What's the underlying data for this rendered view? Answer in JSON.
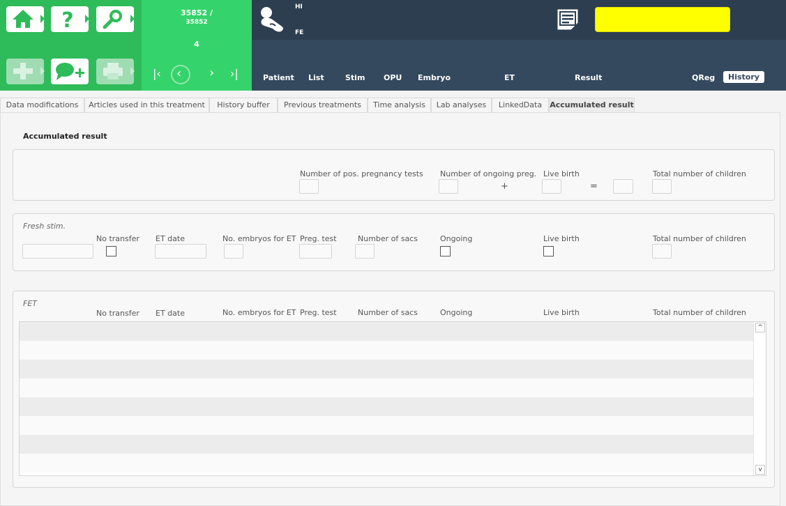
{
  "header": {
    "counter_top": "35852 /",
    "counter_sub": "35852",
    "counter_index": "4",
    "gender_top": "HI",
    "gender_bottom": "FE",
    "nav": {
      "first": "|‹",
      "prev": "‹",
      "next": "›",
      "last": "›|"
    },
    "nav_tabs": [
      "Patient",
      "List",
      "Stim",
      "OPU",
      "Embryo",
      "ET",
      "Result",
      "QReg",
      "History"
    ],
    "active_tab": "History",
    "colors": {
      "green": "#2ebb59",
      "green_light": "#35d36b",
      "dark": "#2c3e50",
      "dark2": "#34495e",
      "highlight": "#ffff00"
    }
  },
  "tabs": [
    "Data modifications",
    "Articles used in this treatment",
    "History buffer",
    "Previous treatments",
    "Time analysis",
    "Lab analyses",
    "LinkedData",
    "Accumulated result"
  ],
  "active_tab": "Accumulated result",
  "section_title": "Accumulated result",
  "summary": {
    "pos_preg_tests": "Number of pos. pregnancy tests",
    "ongoing_preg": "Number of ongoing preg.",
    "plus": "+",
    "live_birth": "Live birth",
    "equals": "=",
    "total_children": "Total number of children"
  },
  "fresh": {
    "title": "Fresh stim.",
    "no_transfer": "No transfer",
    "et_date": "ET date",
    "no_embryos": "No. embryos for ET",
    "preg_test": "Preg. test",
    "num_sacs": "Number of sacs",
    "ongoing": "Ongoing",
    "live_birth": "Live birth",
    "total_children": "Total number of children"
  },
  "fet": {
    "title": "FET",
    "no_transfer": "No transfer",
    "et_date": "ET date",
    "no_embryos": "No. embryos for ET",
    "preg_test": "Preg. test",
    "num_sacs": "Number of sacs",
    "ongoing": "Ongoing",
    "live_birth": "Live birth",
    "total_children": "Total number of children"
  },
  "scroll": {
    "up": "^",
    "down": "v"
  }
}
